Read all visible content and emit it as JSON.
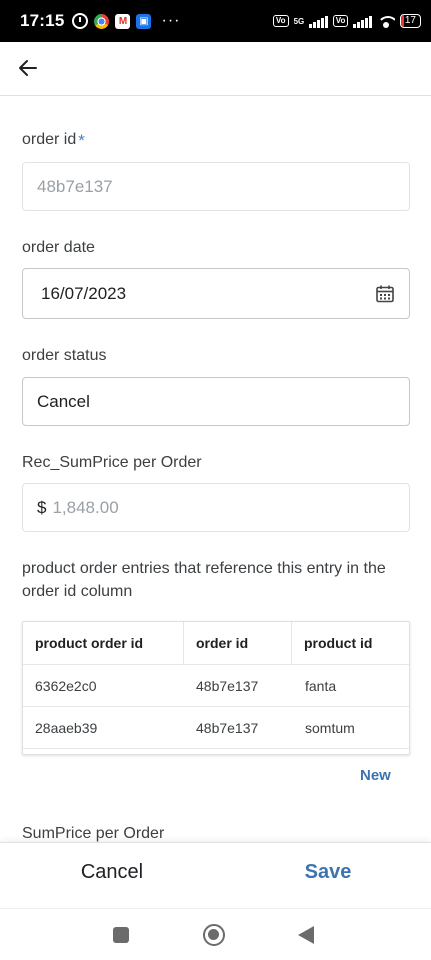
{
  "status_bar": {
    "time": "17:15",
    "notification_icons": [
      "alarm-icon",
      "chrome-icon",
      "gmail-icon",
      "files-icon"
    ],
    "overflow": "···",
    "network": "5G",
    "volte_label": "Vo LTE",
    "battery": "17"
  },
  "form": {
    "order_id": {
      "label": "order id",
      "required_mark": "*",
      "value": "48b7e137"
    },
    "order_date": {
      "label": "order date",
      "value": "16/07/2023"
    },
    "order_status": {
      "label": "order status",
      "value": "Cancel"
    },
    "rec_sumprice": {
      "label": "Rec_SumPrice per Order",
      "currency": "$",
      "value": "1,848.00"
    },
    "references_text": "product order entries that reference this entry in the order id column",
    "table": {
      "columns": [
        "product order id",
        "order id",
        "product id"
      ],
      "rows": [
        [
          "6362e2c0",
          "48b7e137",
          "fanta"
        ],
        [
          "28aaeb39",
          "48b7e137",
          "somtum"
        ]
      ]
    },
    "new_label": "New",
    "sumprice_label": "SumPrice per Order"
  },
  "actions": {
    "cancel_label": "Cancel",
    "save_label": "Save"
  },
  "colors": {
    "accent": "#3b74b0",
    "status_bar_bg": "#000000"
  }
}
